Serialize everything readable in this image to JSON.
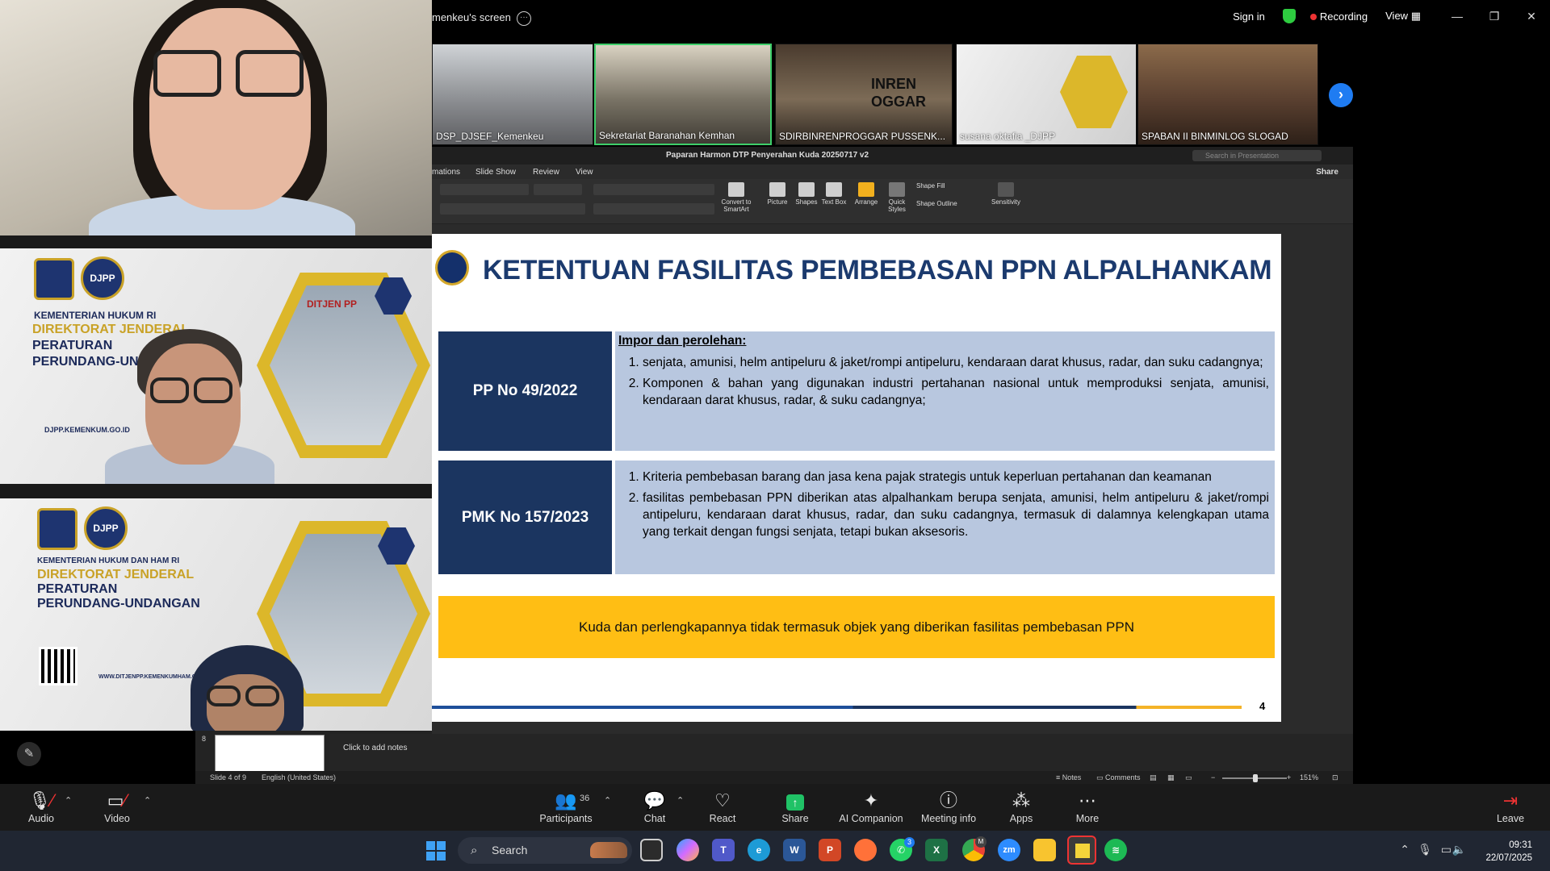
{
  "window": {
    "share_title": "menkeu's screen",
    "sign_in": "Sign in",
    "recording": "Recording",
    "view": "View"
  },
  "thumbnails": [
    {
      "label": "DSP_DJSEF_Kemenkeu",
      "active": false
    },
    {
      "label": "Sekretariat Baranahan Kemhan",
      "active": true
    },
    {
      "label": "SDIRBINRENPROGGAR PUSSENK...",
      "active": false
    },
    {
      "label": "susana oktafia _DJPP",
      "active": false
    },
    {
      "label": "SPABAN II BINMINLOG SLOGAD",
      "active": false
    }
  ],
  "gallery": {
    "tile2": {
      "line1": "KEMENTERIAN HUKUM RI",
      "line2": "DIREKTORAT JENDERAL",
      "line3": "PERATURAN",
      "line4": "PERUNDANG-UNDA",
      "url": "DJPP.KEMENKUM.GO.ID",
      "djpp": "DJPP",
      "hex_sign": "DITJEN PP"
    },
    "tile3": {
      "line1": "KEMENTERIAN HUKUM DAN HAM RI",
      "line2": "DIREKTORAT JENDERAL",
      "line3": "PERATURAN",
      "line4": "PERUNDANG-UNDANGAN",
      "url": "WWW.DITJENPP.KEMENKUMHAM.GO.ID",
      "djpp": "DJPP"
    }
  },
  "ppt": {
    "title": "Paparan Harmon DTP Penyerahan Kuda 20250717 v2",
    "search_placeholder": "Search in Presentation",
    "tabs": [
      "mations",
      "Slide Show",
      "Review",
      "View"
    ],
    "share": "Share",
    "ribbon": [
      {
        "label": "Convert to SmartArt"
      },
      {
        "label": "Picture"
      },
      {
        "label": "Shapes"
      },
      {
        "label": "Text Box"
      },
      {
        "label": "Arrange"
      },
      {
        "label": "Quick Styles"
      },
      {
        "label": "Shape Fill"
      },
      {
        "label": "Shape Outline"
      },
      {
        "label": "Sensitivity"
      }
    ],
    "notes_placeholder": "Click to add notes",
    "film_number": "8",
    "status": {
      "slide": "Slide 4 of 9",
      "language": "English (United States)",
      "notes": "Notes",
      "comments": "Comments",
      "zoom": "151%"
    }
  },
  "slide": {
    "title": "KETENTUAN FASILITAS PEMBEBASAN PPN ALPALHANKAM",
    "rows": [
      {
        "label": "PP No 49/2022",
        "heading": "Impor dan perolehan:",
        "items": [
          "senjata, amunisi, helm antipeluru & jaket/rompi antipeluru, kendaraan darat khusus, radar, dan suku cadangnya;",
          "Komponen & bahan yang digunakan industri pertahanan nasional untuk memproduksi senjata, amunisi, kendaraan darat khusus, radar, & suku cadangnya;"
        ]
      },
      {
        "label": "PMK No 157/2023",
        "heading": "",
        "items": [
          "Kriteria pembebasan barang dan jasa kena pajak strategis untuk keperluan pertahanan dan keamanan",
          "fasilitas pembebasan PPN diberikan atas alpalhankam berupa senjata, amunisi, helm antipeluru & jaket/rompi antipeluru, kendaraan darat khusus, radar, dan suku cadangnya, termasuk di dalamnya kelengkapan utama yang terkait dengan fungsi senjata, tetapi bukan aksesoris."
        ]
      }
    ],
    "note": "Kuda dan perlengkapannya tidak termasuk objek yang diberikan fasilitas pembebasan PPN",
    "page_number": "4"
  },
  "controls": {
    "audio": "Audio",
    "video": "Video",
    "participants": "Participants",
    "participants_count": "36",
    "chat": "Chat",
    "react": "React",
    "share": "Share",
    "ai_companion": "AI Companion",
    "meeting_info": "Meeting info",
    "apps": "Apps",
    "more": "More",
    "leave": "Leave"
  },
  "taskbar": {
    "search": "Search",
    "time": "09:31",
    "date": "22/07/2025",
    "whatsapp_badge": "3",
    "chrome_badge": "M"
  },
  "colors": {
    "slide_title": "#1b3a6e",
    "row_label_bg": "#1b3560",
    "row_box_bg": "#b8c7df",
    "note_bg": "#ffbe14",
    "active_thumb": "#3ecf6a",
    "recording_dot": "#e33333"
  }
}
